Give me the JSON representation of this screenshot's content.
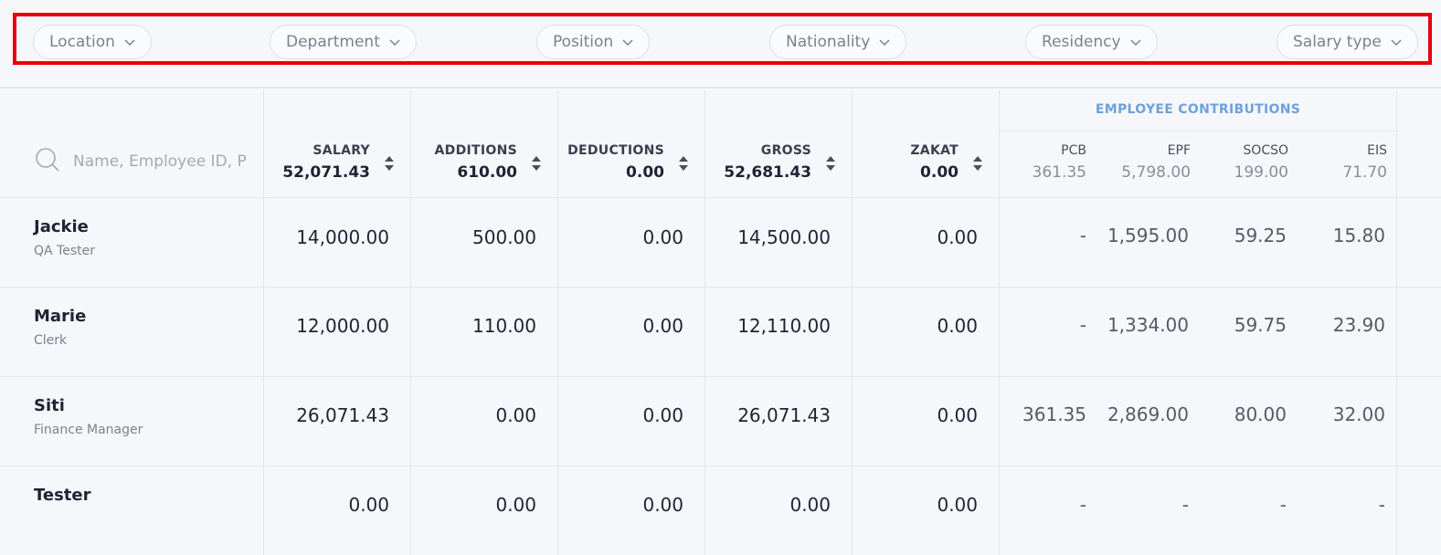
{
  "filters": [
    {
      "label": "Location"
    },
    {
      "label": "Department"
    },
    {
      "label": "Position"
    },
    {
      "label": "Nationality"
    },
    {
      "label": "Residency"
    },
    {
      "label": "Salary type"
    }
  ],
  "search": {
    "placeholder": "Name, Employee ID, Passport"
  },
  "columns": [
    {
      "label": "SALARY",
      "total": "52,071.43"
    },
    {
      "label": "ADDITIONS",
      "total": "610.00"
    },
    {
      "label": "DEDUCTIONS",
      "total": "0.00"
    },
    {
      "label": "GROSS",
      "total": "52,681.43"
    },
    {
      "label": "ZAKAT",
      "total": "0.00"
    }
  ],
  "contributions": {
    "title": "EMPLOYEE CONTRIBUTIONS",
    "columns": [
      {
        "label": "PCB",
        "total": "361.35"
      },
      {
        "label": "EPF",
        "total": "5,798.00"
      },
      {
        "label": "SOCSO",
        "total": "199.00"
      },
      {
        "label": "EIS",
        "total": "71.70"
      }
    ]
  },
  "rows": [
    {
      "name": "Jackie",
      "position": "QA Tester",
      "salary": "14,000.00",
      "additions": "500.00",
      "deductions": "0.00",
      "gross": "14,500.00",
      "zakat": "0.00",
      "pcb": "-",
      "epf": "1,595.00",
      "socso": "59.25",
      "eis": "15.80"
    },
    {
      "name": "Marie",
      "position": "Clerk",
      "salary": "12,000.00",
      "additions": "110.00",
      "deductions": "0.00",
      "gross": "12,110.00",
      "zakat": "0.00",
      "pcb": "-",
      "epf": "1,334.00",
      "socso": "59.75",
      "eis": "23.90"
    },
    {
      "name": "Siti",
      "position": "Finance Manager",
      "salary": "26,071.43",
      "additions": "0.00",
      "deductions": "0.00",
      "gross": "26,071.43",
      "zakat": "0.00",
      "pcb": "361.35",
      "epf": "2,869.00",
      "socso": "80.00",
      "eis": "32.00"
    },
    {
      "name": "Tester",
      "position": "",
      "salary": "0.00",
      "additions": "0.00",
      "deductions": "0.00",
      "gross": "0.00",
      "zakat": "0.00",
      "pcb": "-",
      "epf": "-",
      "socso": "-",
      "eis": "-"
    }
  ],
  "colors": {
    "highlight": "#e8000b",
    "accent": "#6ea1dc"
  }
}
